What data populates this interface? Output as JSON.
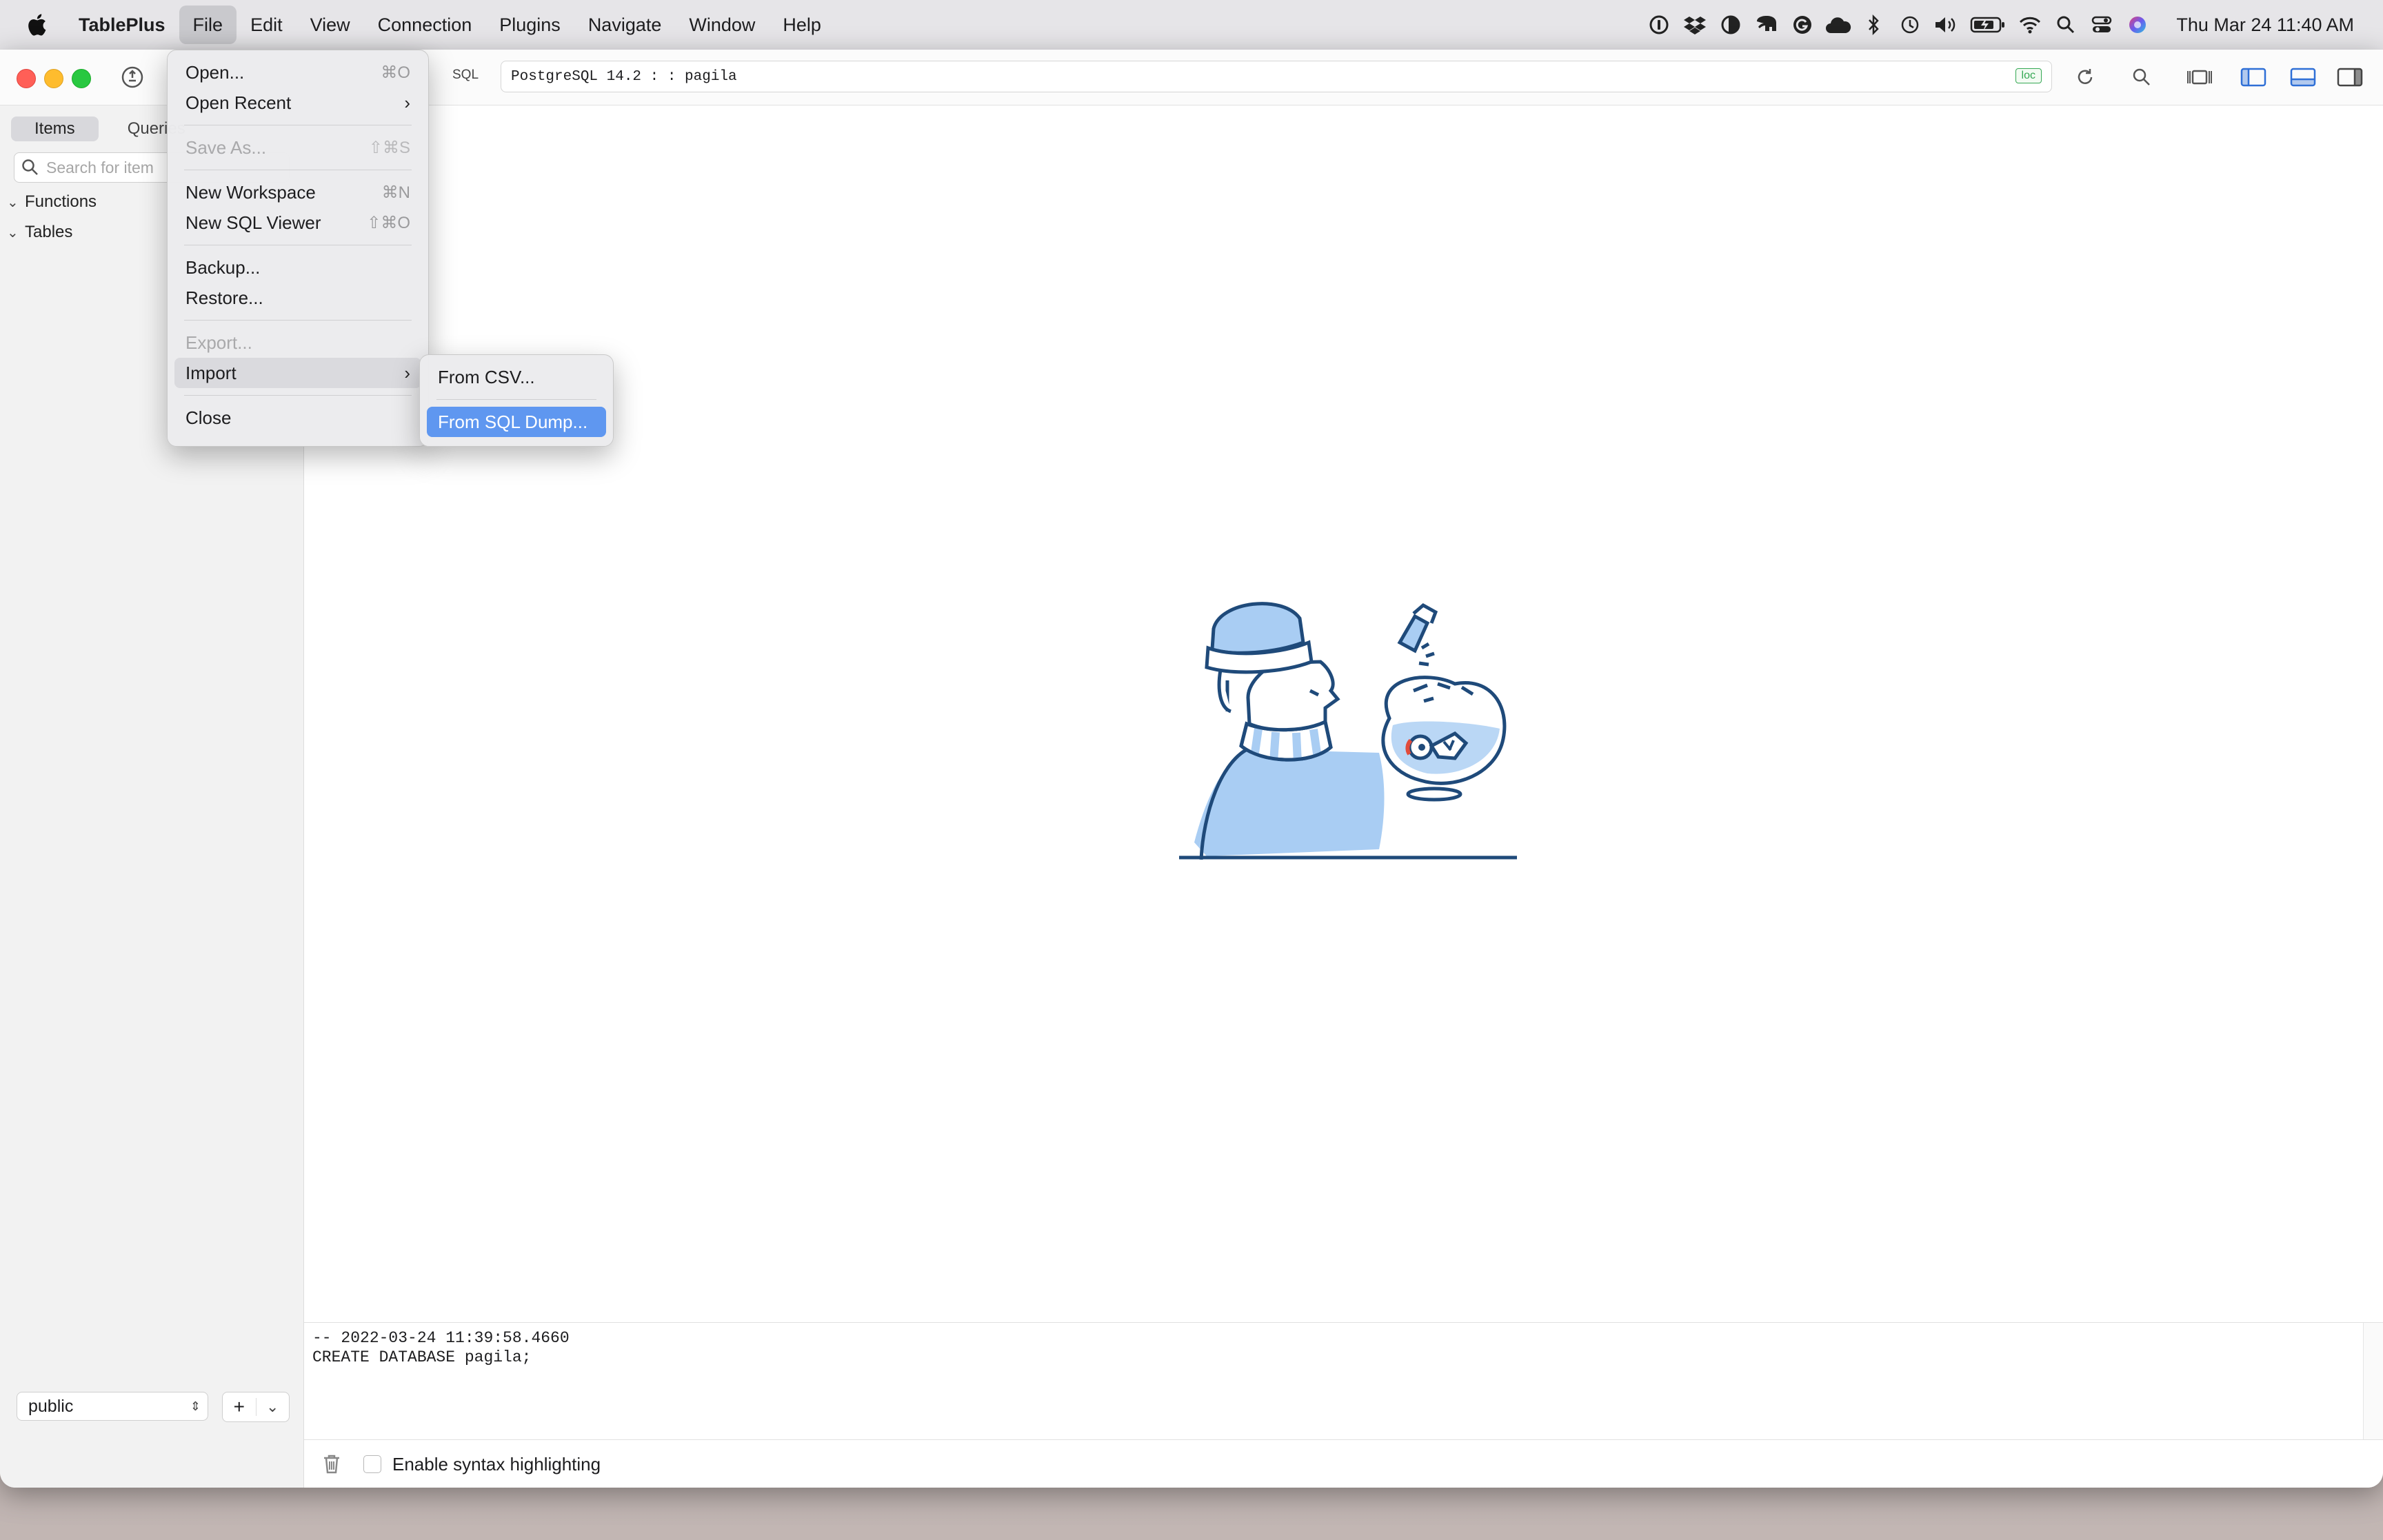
{
  "menubar": {
    "apple_icon": "apple-logo-icon",
    "app_name": "TablePlus",
    "menus": [
      "File",
      "Edit",
      "View",
      "Connection",
      "Plugins",
      "Navigate",
      "Window",
      "Help"
    ],
    "active_menu": "File",
    "status_icons": [
      "1password-icon",
      "dropbox-icon",
      "contrast-icon",
      "elephant-icon",
      "grammarly-icon",
      "cloud-icon",
      "bluetooth-icon",
      "time-machine-icon",
      "volume-icon",
      "battery-icon",
      "wifi-icon",
      "search-icon",
      "control-center-icon",
      "siri-icon"
    ],
    "clock": "Thu Mar 24  11:40 AM"
  },
  "toolbar": {
    "sql_label": "SQL",
    "connection_text": "PostgreSQL 14.2 :  : pagila",
    "loc_badge": "loc"
  },
  "sidebar": {
    "tabs": [
      "Items",
      "Queries"
    ],
    "search_placeholder": "Search for item",
    "tree": [
      "Functions",
      "Tables"
    ],
    "schema": "public",
    "add_label": "+",
    "add_dropdown": "⌄"
  },
  "file_menu": {
    "items": [
      {
        "label": "Open...",
        "shortcut": "⌘O"
      },
      {
        "label": "Open Recent",
        "submenu": true
      },
      {
        "label": "Save As...",
        "shortcut": "⇧⌘S",
        "disabled": true
      },
      {
        "label": "New Workspace",
        "shortcut": "⌘N"
      },
      {
        "label": "New SQL Viewer",
        "shortcut": "⇧⌘O"
      },
      {
        "label": "Backup..."
      },
      {
        "label": "Restore..."
      },
      {
        "label": "Export...",
        "disabled": true
      },
      {
        "label": "Import",
        "submenu": true,
        "highlighted": true
      },
      {
        "label": "Close"
      }
    ]
  },
  "import_submenu": {
    "items": [
      {
        "label": "From CSV..."
      },
      {
        "label": "From SQL Dump...",
        "selected": true
      }
    ]
  },
  "log": {
    "lines": [
      "-- 2022-03-24 11:39:58.4660",
      "CREATE DATABASE pagila;"
    ]
  },
  "bottom": {
    "syntax_label": "Enable syntax highlighting",
    "syntax_checked": false
  },
  "colors": {
    "accent": "#5f97f0",
    "illustration_line": "#1f4a7a",
    "illustration_fill": "#a9cdf3",
    "loc_green": "#34a853"
  }
}
